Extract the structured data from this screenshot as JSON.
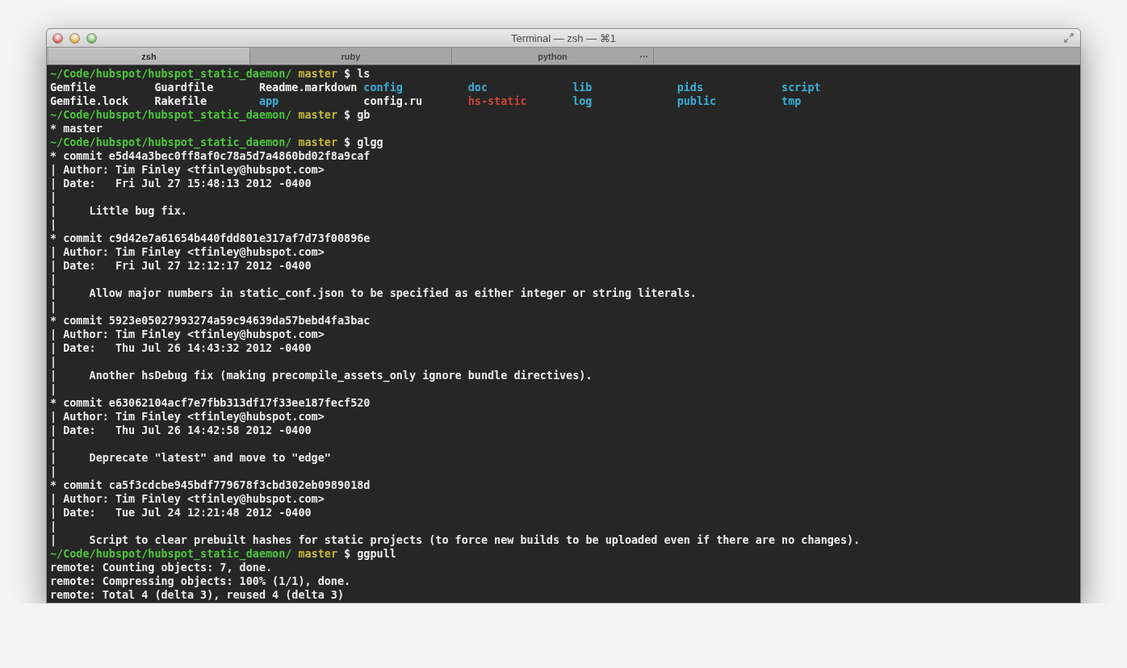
{
  "window": {
    "title": "Terminal — zsh — ⌘1"
  },
  "tabs": [
    {
      "label": "zsh",
      "selected": true
    },
    {
      "label": "ruby",
      "selected": false
    },
    {
      "label": "python",
      "selected": false,
      "indicator": "…"
    }
  ],
  "lines": [
    {
      "kind": "prompt",
      "path": "~/Code/hubspot/hubspot_static_daemon/",
      "branch": "master",
      "symbol": "$",
      "command": "ls"
    },
    {
      "kind": "listing",
      "entries": [
        {
          "name": "Gemfile",
          "color": "#f2f2f2"
        },
        {
          "name": "Guardfile",
          "color": "#f2f2f2"
        },
        {
          "name": "Readme.markdown",
          "color": "#f2f2f2"
        },
        {
          "name": "config",
          "color": "#3aaed6"
        },
        {
          "name": "doc",
          "color": "#3aaed6"
        },
        {
          "name": "lib",
          "color": "#3aaed6"
        },
        {
          "name": "pids",
          "color": "#3aaed6"
        },
        {
          "name": "script",
          "color": "#3aaed6"
        },
        {
          "name": "Gemfile.lock",
          "color": "#f2f2f2"
        },
        {
          "name": "Rakefile",
          "color": "#f2f2f2"
        },
        {
          "name": "app",
          "color": "#3aaed6"
        },
        {
          "name": "config.ru",
          "color": "#f2f2f2"
        },
        {
          "name": "hs-static",
          "color": "#c9443a"
        },
        {
          "name": "log",
          "color": "#3aaed6"
        },
        {
          "name": "public",
          "color": "#3aaed6"
        },
        {
          "name": "tmp",
          "color": "#3aaed6"
        }
      ]
    },
    {
      "kind": "prompt",
      "path": "~/Code/hubspot/hubspot_static_daemon/",
      "branch": "master",
      "symbol": "$",
      "command": "gb"
    },
    {
      "kind": "text",
      "text": "* master"
    },
    {
      "kind": "prompt",
      "path": "~/Code/hubspot/hubspot_static_daemon/",
      "branch": "master",
      "symbol": "$",
      "command": "glgg"
    },
    {
      "kind": "text",
      "text": "* commit e5d44a3bec0ff8af0c78a5d7a4860bd02f8a9caf"
    },
    {
      "kind": "text",
      "text": "| Author: Tim Finley <tfinley@hubspot.com>"
    },
    {
      "kind": "text",
      "text": "| Date:   Fri Jul 27 15:48:13 2012 -0400"
    },
    {
      "kind": "text",
      "text": "|"
    },
    {
      "kind": "text",
      "text": "|     Little bug fix."
    },
    {
      "kind": "text",
      "text": "|"
    },
    {
      "kind": "text",
      "text": "* commit c9d42e7a61654b440fdd801e317af7d73f00896e"
    },
    {
      "kind": "text",
      "text": "| Author: Tim Finley <tfinley@hubspot.com>"
    },
    {
      "kind": "text",
      "text": "| Date:   Fri Jul 27 12:12:17 2012 -0400"
    },
    {
      "kind": "text",
      "text": "|"
    },
    {
      "kind": "text",
      "text": "|     Allow major numbers in static_conf.json to be specified as either integer or string literals."
    },
    {
      "kind": "text",
      "text": "|"
    },
    {
      "kind": "text",
      "text": "* commit 5923e05027993274a59c94639da57bebd4fa3bac"
    },
    {
      "kind": "text",
      "text": "| Author: Tim Finley <tfinley@hubspot.com>"
    },
    {
      "kind": "text",
      "text": "| Date:   Thu Jul 26 14:43:32 2012 -0400"
    },
    {
      "kind": "text",
      "text": "|"
    },
    {
      "kind": "text",
      "text": "|     Another hsDebug fix (making precompile_assets_only ignore bundle directives)."
    },
    {
      "kind": "text",
      "text": "|"
    },
    {
      "kind": "text",
      "text": "* commit e63062104acf7e7fbb313df17f33ee187fecf520"
    },
    {
      "kind": "text",
      "text": "| Author: Tim Finley <tfinley@hubspot.com>"
    },
    {
      "kind": "text",
      "text": "| Date:   Thu Jul 26 14:42:58 2012 -0400"
    },
    {
      "kind": "text",
      "text": "|"
    },
    {
      "kind": "text",
      "text": "|     Deprecate \"latest\" and move to \"edge\""
    },
    {
      "kind": "text",
      "text": "|"
    },
    {
      "kind": "text",
      "text": "* commit ca5f3cdcbe945bdf779678f3cbd302eb0989018d"
    },
    {
      "kind": "text",
      "text": "| Author: Tim Finley <tfinley@hubspot.com>"
    },
    {
      "kind": "text",
      "text": "| Date:   Tue Jul 24 12:21:48 2012 -0400"
    },
    {
      "kind": "text",
      "text": "|"
    },
    {
      "kind": "text",
      "text": "|     Script to clear prebuilt hashes for static projects (to force new builds to be uploaded even if there are no changes)."
    },
    {
      "kind": "prompt",
      "path": "~/Code/hubspot/hubspot_static_daemon/",
      "branch": "master",
      "symbol": "$",
      "command": "ggpull"
    },
    {
      "kind": "text",
      "text": "remote: Counting objects: 7, done."
    },
    {
      "kind": "text",
      "text": "remote: Compressing objects: 100% (1/1), done."
    },
    {
      "kind": "text",
      "text": "remote: Total 4 (delta 3), reused 4 (delta 3)"
    }
  ]
}
